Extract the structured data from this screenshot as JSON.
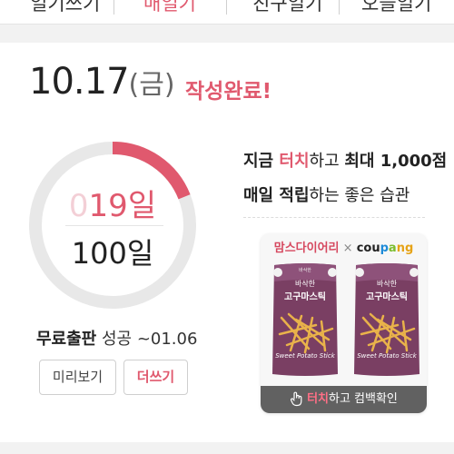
{
  "tabs": [
    "일기쓰기",
    "매일기",
    "친구일기",
    "오늘일기"
  ],
  "entry": {
    "date": "10.17",
    "weekday": "(금)",
    "status": "작성완료!"
  },
  "progress": {
    "current_prefix": "0",
    "current_value": "19",
    "current_unit": "일",
    "goal": "100일",
    "fraction": 0.19
  },
  "publish": {
    "bold": "무료출판",
    "rest": " 성공 ~01.06"
  },
  "buttons": {
    "preview": "미리보기",
    "write_more": "더쓰기"
  },
  "promo": {
    "line1_a": "지금 ",
    "line1_pink": "터치",
    "line1_b": "하고 ",
    "line1_bold": "최대 1,000점",
    "line2_bold": "매일 적립",
    "line2_rest": "하는 좋은 습관"
  },
  "ad": {
    "brand_left": "맘스다이어리",
    "brand_x": " × ",
    "brand_right_a": "cou",
    "brand_right_b": "p",
    "brand_right_c": "a",
    "brand_right_d": "ng",
    "product_top": "바삭한",
    "product_name": "고구마스틱",
    "product_en": "Sweet Potato Stick",
    "cta_pink": "터치",
    "cta_rest": "하고 컴백확인"
  },
  "colors": {
    "accent": "#e0596e",
    "ring_track": "#e8e8e8"
  },
  "icons": {
    "cta": "pointing-hand-icon"
  }
}
